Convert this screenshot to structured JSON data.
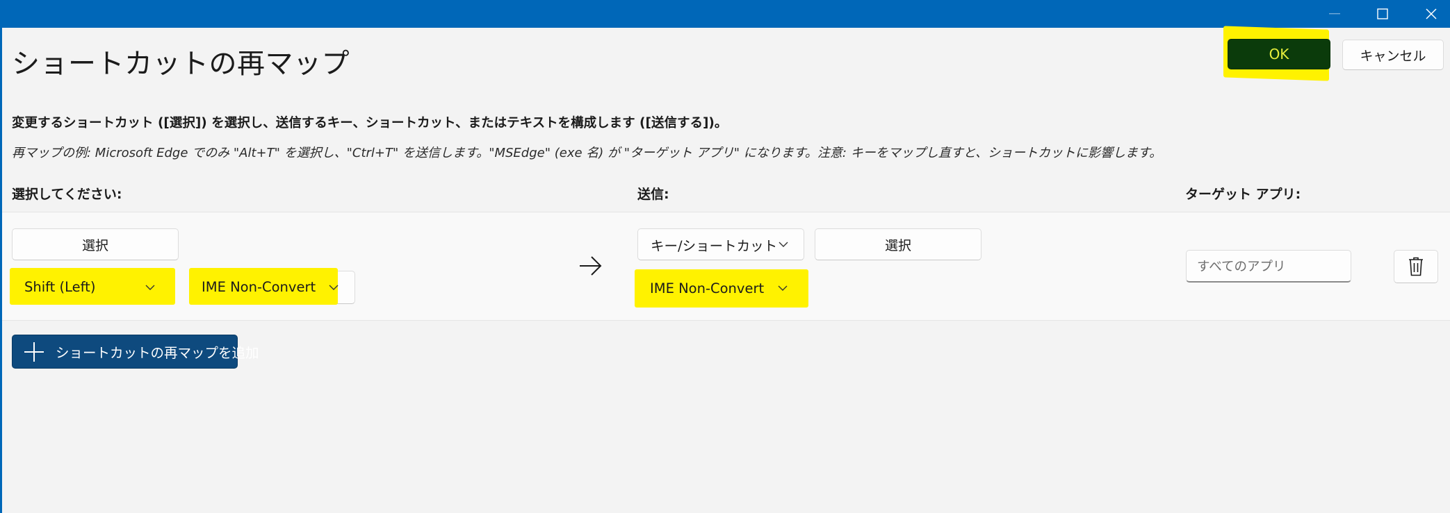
{
  "window": {
    "minimize_glyph": "—",
    "maximize_icon": "maximize-icon",
    "close_icon": "close-icon"
  },
  "header": {
    "title": "ショートカットの再マップ",
    "ok_label": "OK",
    "cancel_label": "キャンセル"
  },
  "description": {
    "main": "変更するショートカット ([選択]) を選択し、送信するキー、ショートカット、またはテキストを構成します ([送信する])。",
    "example": "再マップの例: Microsoft Edge でのみ \"Alt+T\" を選択し、\"Ctrl+T\" を送信します。\"MSEdge\" (exe 名) が \"ターゲット アプリ\" になります。注意: キーをマップし直すと、ショートカットに影響します。"
  },
  "columns": {
    "select": "選択してください:",
    "send": "送信:",
    "target": "ターゲット アプリ:"
  },
  "row": {
    "select_button": "選択",
    "select_keys": [
      "Shift (Left)",
      "IME Non-Convert"
    ],
    "send_type": "キー/ショートカット",
    "send_select_button": "選択",
    "send_keys": [
      "IME Non-Convert"
    ],
    "target_placeholder": "すべてのアプリ"
  },
  "add_button_label": "ショートカットの再マップを追加",
  "colors": {
    "titlebar": "#0067b8",
    "highlight": "#fff200",
    "ok_background": "#0b3b0b",
    "accent_button": "#0e4a7e"
  },
  "icons": [
    "minimize-icon",
    "maximize-icon",
    "close-icon",
    "chevron-down-icon",
    "arrow-right-icon",
    "trash-icon",
    "plus-icon"
  ]
}
